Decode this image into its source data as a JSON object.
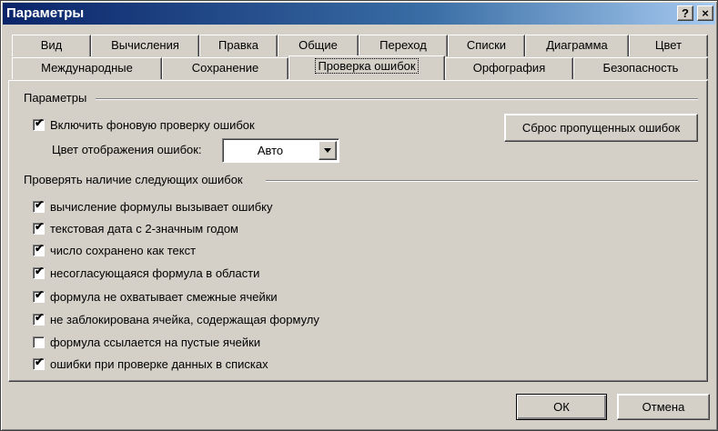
{
  "window": {
    "title": "Параметры",
    "help_label": "?",
    "close_label": "×"
  },
  "tabs_row1": [
    "Вид",
    "Вычисления",
    "Правка",
    "Общие",
    "Переход",
    "Списки",
    "Диаграмма",
    "Цвет"
  ],
  "tabs_row2": [
    "Международные",
    "Сохранение",
    "Проверка ошибок",
    "Орфография",
    "Безопасность"
  ],
  "active_tab": "Проверка ошибок",
  "settings": {
    "group_label": "Параметры",
    "background_check": {
      "label": "Включить фоновую проверку ошибок",
      "checked": true
    },
    "reset_button": "Сброс пропущенных ошибок",
    "color_label": "Цвет отображения ошибок:",
    "color_value": "Авто"
  },
  "rules": {
    "group_label": "Проверять наличие следующих ошибок",
    "items": [
      {
        "label": "вычисление формулы вызывает ошибку",
        "checked": true
      },
      {
        "label": "текстовая дата с 2-значным годом",
        "checked": true
      },
      {
        "label": "число сохранено как текст",
        "checked": true
      },
      {
        "label": "несогласующаяся формула в области",
        "checked": true
      },
      {
        "label": "формула не охватывает смежные ячейки",
        "checked": true
      },
      {
        "label": "не заблокирована ячейка, содержащая формулу",
        "checked": true
      },
      {
        "label": "формула ссылается на пустые ячейки",
        "checked": false
      },
      {
        "label": "ошибки при проверке данных в списках",
        "checked": true
      }
    ]
  },
  "footer": {
    "ok": "ОК",
    "cancel": "Отмена"
  }
}
